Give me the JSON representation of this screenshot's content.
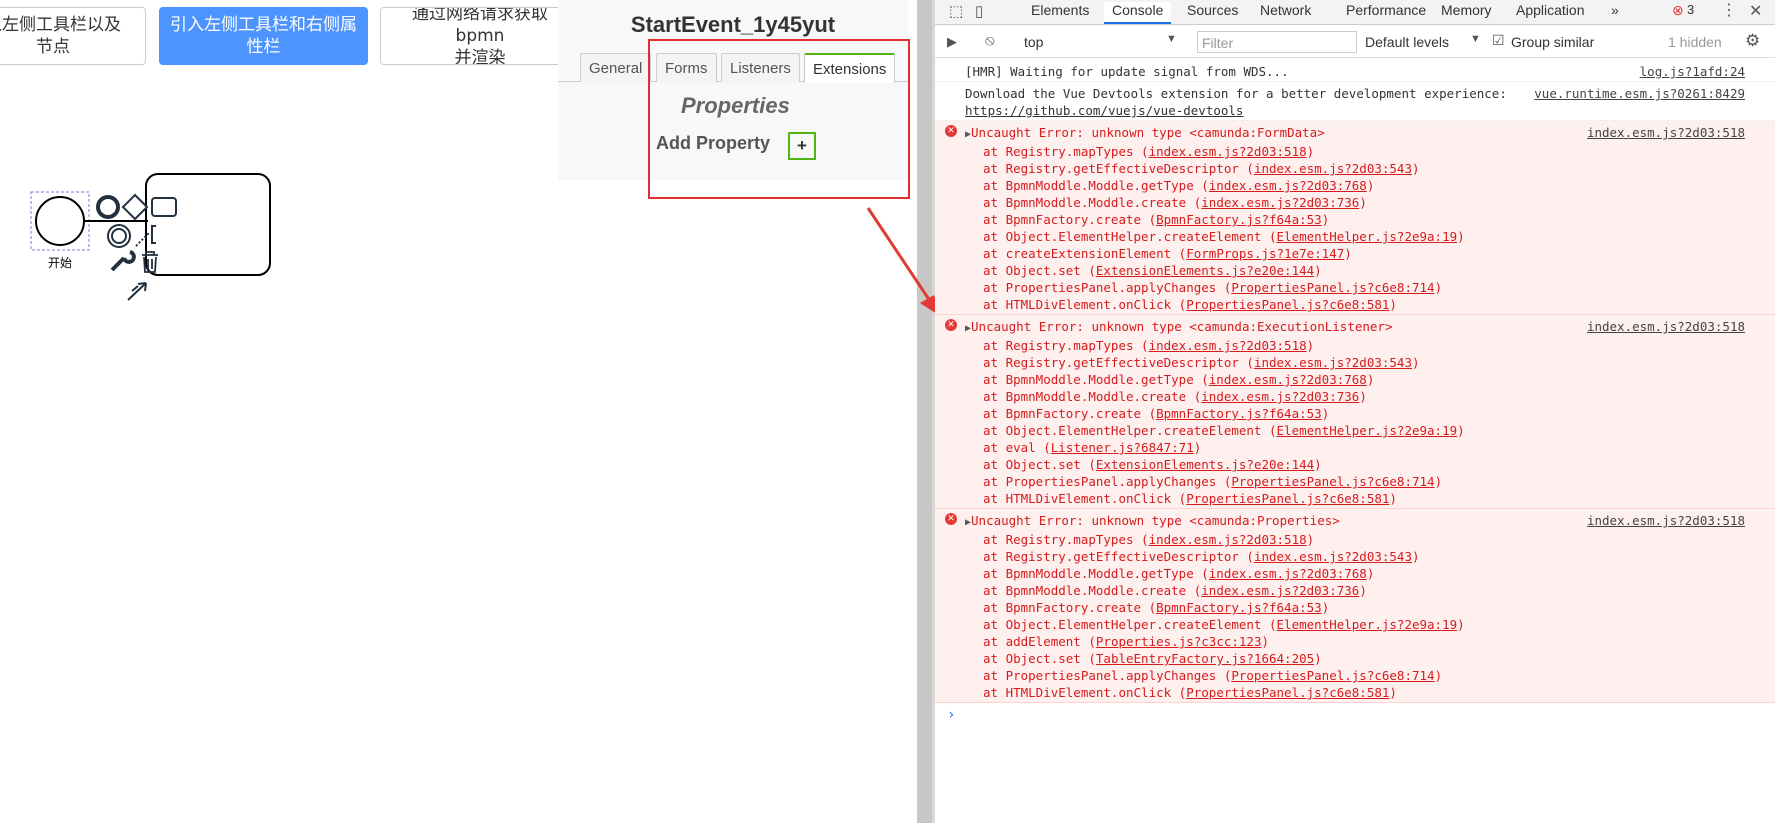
{
  "buttons": {
    "b1": "入左侧工具栏以及\n节点",
    "b2": "引入左侧工具栏和右侧属\n性栏",
    "b3": "通过网络请求获取bpmn\n并渲染"
  },
  "panel": {
    "title": "StartEvent_1y45yut",
    "tabs": [
      "General",
      "Forms",
      "Listeners",
      "Extensions"
    ],
    "properties_title": "Properties",
    "add_label": "Add Property",
    "add_button": "+"
  },
  "canvas": {
    "start_label": "开始"
  },
  "devtools": {
    "tabs": [
      "Elements",
      "Console",
      "Sources",
      "Network",
      "Performance",
      "Memory",
      "Application"
    ],
    "more": "»",
    "error_count": "3",
    "context": "top",
    "filter_placeholder": "Filter",
    "levels": "Default levels",
    "group_similar": "Group similar",
    "hidden": "1 hidden",
    "messages": [
      {
        "text": "[HMR] Waiting for update signal from WDS...",
        "src": "log.js?1afd:24"
      },
      {
        "text": "Download the Vue Devtools extension for a better development experience:",
        "link": "https://github.com/vuejs/vue-devtools",
        "src": "vue.runtime.esm.js?0261:8429"
      }
    ],
    "errors": [
      {
        "title": "Uncaught Error: unknown type <camunda:FormData>",
        "src": "index.esm.js?2d03:518",
        "frames": [
          {
            "fn": "at Registry.mapTypes",
            "loc": "index.esm.js?2d03:518"
          },
          {
            "fn": "at Registry.getEffectiveDescriptor",
            "loc": "index.esm.js?2d03:543"
          },
          {
            "fn": "at BpmnModdle.Moddle.getType",
            "loc": "index.esm.js?2d03:768"
          },
          {
            "fn": "at BpmnModdle.Moddle.create",
            "loc": "index.esm.js?2d03:736"
          },
          {
            "fn": "at BpmnFactory.create",
            "loc": "BpmnFactory.js?f64a:53"
          },
          {
            "fn": "at Object.ElementHelper.createElement",
            "loc": "ElementHelper.js?2e9a:19"
          },
          {
            "fn": "at createExtensionElement",
            "loc": "FormProps.js?1e7e:147"
          },
          {
            "fn": "at Object.set",
            "loc": "ExtensionElements.js?e20e:144"
          },
          {
            "fn": "at PropertiesPanel.applyChanges",
            "loc": "PropertiesPanel.js?c6e8:714"
          },
          {
            "fn": "at HTMLDivElement.onClick",
            "loc": "PropertiesPanel.js?c6e8:581"
          }
        ]
      },
      {
        "title": "Uncaught Error: unknown type <camunda:ExecutionListener>",
        "src": "index.esm.js?2d03:518",
        "frames": [
          {
            "fn": "at Registry.mapTypes",
            "loc": "index.esm.js?2d03:518"
          },
          {
            "fn": "at Registry.getEffectiveDescriptor",
            "loc": "index.esm.js?2d03:543"
          },
          {
            "fn": "at BpmnModdle.Moddle.getType",
            "loc": "index.esm.js?2d03:768"
          },
          {
            "fn": "at BpmnModdle.Moddle.create",
            "loc": "index.esm.js?2d03:736"
          },
          {
            "fn": "at BpmnFactory.create",
            "loc": "BpmnFactory.js?f64a:53"
          },
          {
            "fn": "at Object.ElementHelper.createElement",
            "loc": "ElementHelper.js?2e9a:19"
          },
          {
            "fn": "at eval",
            "loc": "Listener.js?6847:71"
          },
          {
            "fn": "at Object.set",
            "loc": "ExtensionElements.js?e20e:144"
          },
          {
            "fn": "at PropertiesPanel.applyChanges",
            "loc": "PropertiesPanel.js?c6e8:714"
          },
          {
            "fn": "at HTMLDivElement.onClick",
            "loc": "PropertiesPanel.js?c6e8:581"
          }
        ]
      },
      {
        "title": "Uncaught Error: unknown type <camunda:Properties>",
        "src": "index.esm.js?2d03:518",
        "frames": [
          {
            "fn": "at Registry.mapTypes",
            "loc": "index.esm.js?2d03:518"
          },
          {
            "fn": "at Registry.getEffectiveDescriptor",
            "loc": "index.esm.js?2d03:543"
          },
          {
            "fn": "at BpmnModdle.Moddle.getType",
            "loc": "index.esm.js?2d03:768"
          },
          {
            "fn": "at BpmnModdle.Moddle.create",
            "loc": "index.esm.js?2d03:736"
          },
          {
            "fn": "at BpmnFactory.create",
            "loc": "BpmnFactory.js?f64a:53"
          },
          {
            "fn": "at Object.ElementHelper.createElement",
            "loc": "ElementHelper.js?2e9a:19"
          },
          {
            "fn": "at addElement",
            "loc": "Properties.js?c3cc:123"
          },
          {
            "fn": "at Object.set",
            "loc": "TableEntryFactory.js?1664:205"
          },
          {
            "fn": "at PropertiesPanel.applyChanges",
            "loc": "PropertiesPanel.js?c6e8:714"
          },
          {
            "fn": "at HTMLDivElement.onClick",
            "loc": "PropertiesPanel.js?c6e8:581"
          }
        ]
      }
    ],
    "prompt": "›"
  },
  "colors": {
    "accent": "#4d94ff",
    "error": "#d61b1b",
    "highlight": "#e03030",
    "active_tab": "#52b415"
  }
}
